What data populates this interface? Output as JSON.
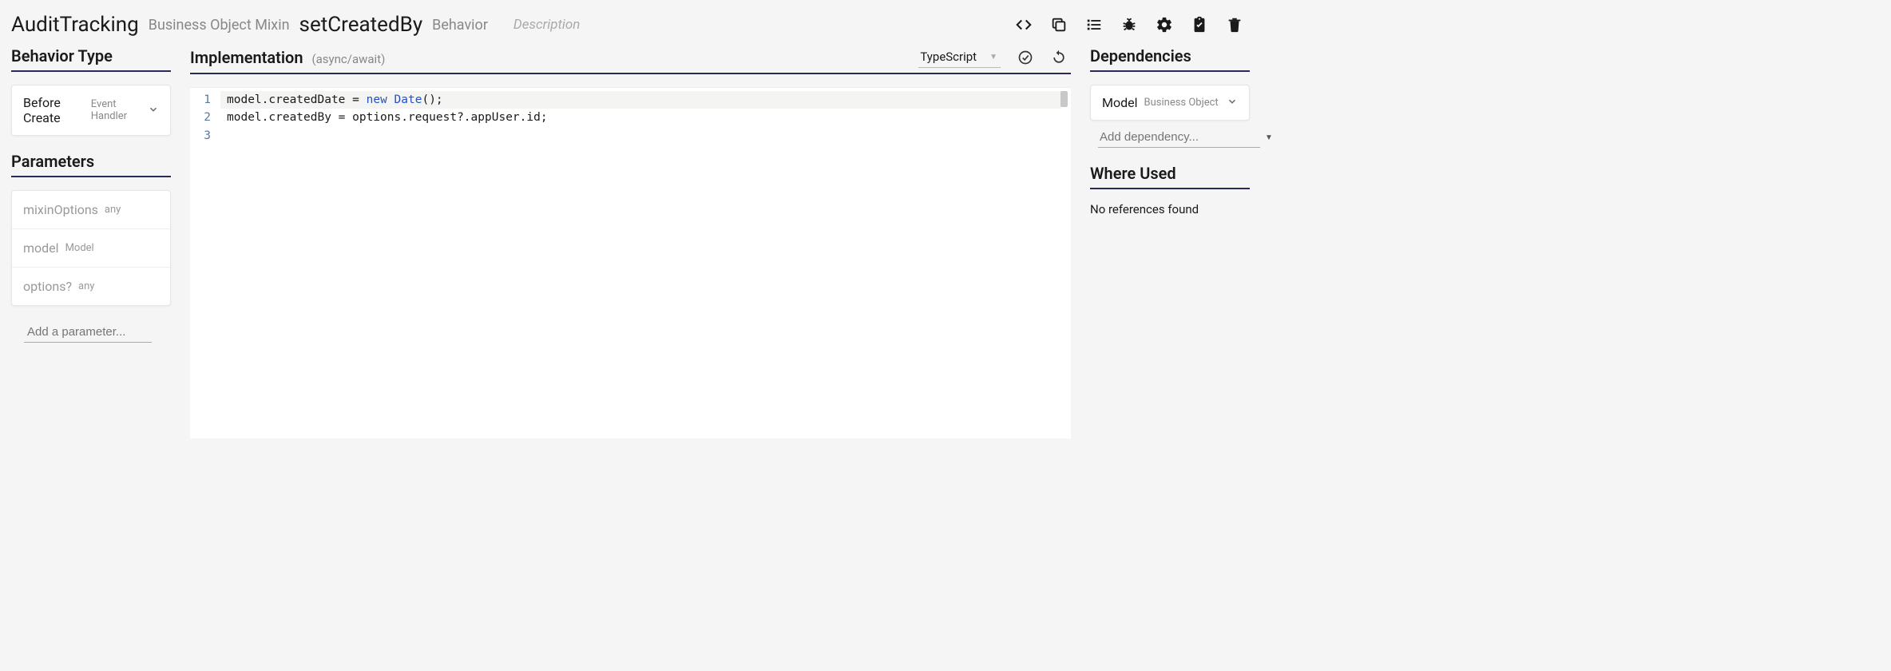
{
  "header": {
    "object_name": "AuditTracking",
    "object_type": "Business Object Mixin",
    "behavior_name": "setCreatedBy",
    "behavior_label": "Behavior",
    "description_placeholder": "Description"
  },
  "left": {
    "behavior_type_title": "Behavior Type",
    "behavior_type": {
      "label": "Before Create",
      "sublabel": "Event Handler"
    },
    "parameters_title": "Parameters",
    "parameters": [
      {
        "name": "mixinOptions",
        "type": "any"
      },
      {
        "name": "model",
        "type": "Model"
      },
      {
        "name": "options?",
        "type": "any"
      }
    ],
    "add_parameter_placeholder": "Add a parameter..."
  },
  "mid": {
    "implementation_title": "Implementation",
    "implementation_suffix": "(async/await)",
    "language": "TypeScript",
    "code_lines": [
      {
        "n": "1",
        "tokens": [
          {
            "t": "model.createdDate = ",
            "c": "plain"
          },
          {
            "t": "new",
            "c": "kw"
          },
          {
            "t": " ",
            "c": "plain"
          },
          {
            "t": "Date",
            "c": "kw"
          },
          {
            "t": "();",
            "c": "plain"
          }
        ]
      },
      {
        "n": "2",
        "tokens": [
          {
            "t": "model.createdBy = options.request?.appUser.id;",
            "c": "plain"
          }
        ]
      },
      {
        "n": "3",
        "tokens": []
      }
    ]
  },
  "right": {
    "dependencies_title": "Dependencies",
    "dependencies": [
      {
        "label": "Model",
        "sublabel": "Business Object"
      }
    ],
    "add_dependency_placeholder": "Add dependency...",
    "where_used_title": "Where Used",
    "where_used_text": "No references found"
  }
}
